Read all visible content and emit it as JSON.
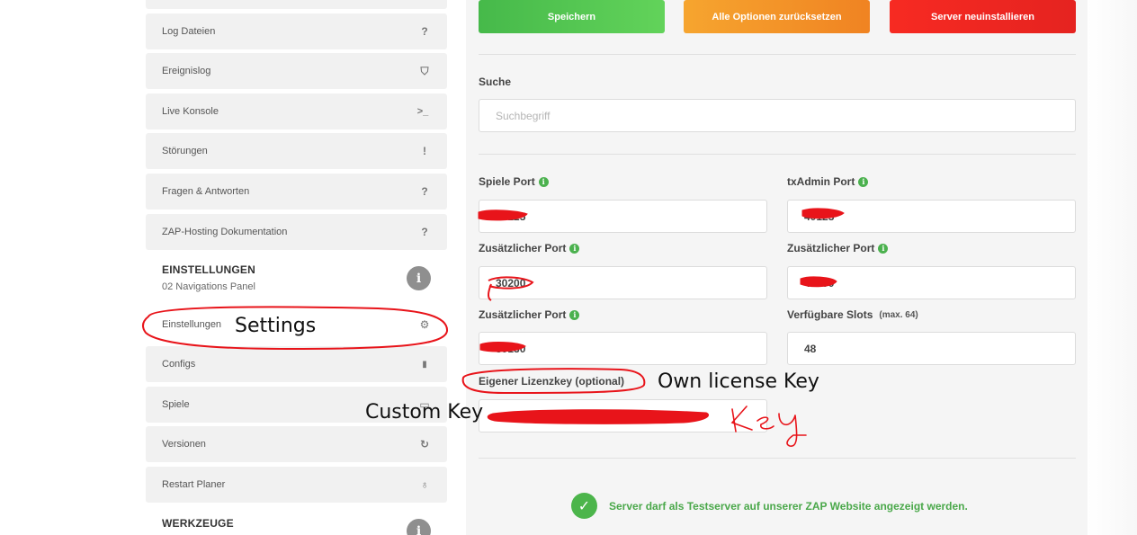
{
  "sidebar": {
    "items": [
      {
        "label": "Log Dateien",
        "icon": "question-icon",
        "glyph": "?"
      },
      {
        "label": "Ereignislog",
        "icon": "shield-icon",
        "glyph": "⛉"
      },
      {
        "label": "Live Konsole",
        "icon": "terminal-icon",
        "glyph": ">_"
      },
      {
        "label": "Störungen",
        "icon": "exclamation-icon",
        "glyph": "!"
      },
      {
        "label": "Fragen & Antworten",
        "icon": "question-icon",
        "glyph": "?"
      },
      {
        "label": "ZAP-Hosting Dokumentation",
        "icon": "question-icon",
        "glyph": "?"
      }
    ],
    "settings_section": {
      "title": "EINSTELLUNGEN",
      "subtitle": "02 Navigations Panel",
      "info_glyph": "i"
    },
    "settings_items": [
      {
        "label": "Einstellungen",
        "icon": "gears-icon",
        "glyph": "⚙"
      },
      {
        "label": "Configs",
        "icon": "file-icon",
        "glyph": "▮"
      },
      {
        "label": "Spiele",
        "icon": "gamepad-icon",
        "glyph": "▭"
      },
      {
        "label": "Versionen",
        "icon": "refresh-icon",
        "glyph": "↻"
      },
      {
        "label": "Restart Planer",
        "icon": "lightbulb-icon",
        "glyph": "♁"
      }
    ],
    "tools_section": {
      "title": "WERKZEUGE",
      "info_glyph": "i"
    }
  },
  "toolbar": {
    "save_label": "Speichern",
    "reset_label": "Alle Optionen zurücksetzen",
    "reinstall_label": "Server neuinstallieren"
  },
  "search": {
    "label": "Suche",
    "placeholder": "Suchbegriff"
  },
  "fields": {
    "game_port": {
      "label": "Spiele Port",
      "value": "30125"
    },
    "txadmin_port": {
      "label": "txAdmin Port",
      "value": "40125"
    },
    "extra_port_1": {
      "label": "Zusätzlicher Port",
      "value": "30200"
    },
    "extra_port_2": {
      "label": "Zusätzlicher Port",
      "value": "40200"
    },
    "extra_port_3": {
      "label": "Zusätzlicher Port",
      "value": "30130"
    },
    "slots": {
      "label": "Verfügbare Slots",
      "hint": "(max. 64)",
      "value": "48"
    },
    "license_key": {
      "label": "Eigener Lizenzkey (optional)",
      "value": ""
    }
  },
  "test_server": {
    "text": "Server darf als Testserver auf unserer ZAP Website angezeigt werden.",
    "checked": true
  },
  "annotations": {
    "settings": "Settings",
    "own_license": "Own license Key",
    "custom_key": "Custom Key",
    "key_scribble": "key"
  },
  "colors": {
    "accent_green": "#4cb54b",
    "orange": "#f08322",
    "red": "#e52320",
    "scribble": "#e8141a"
  }
}
